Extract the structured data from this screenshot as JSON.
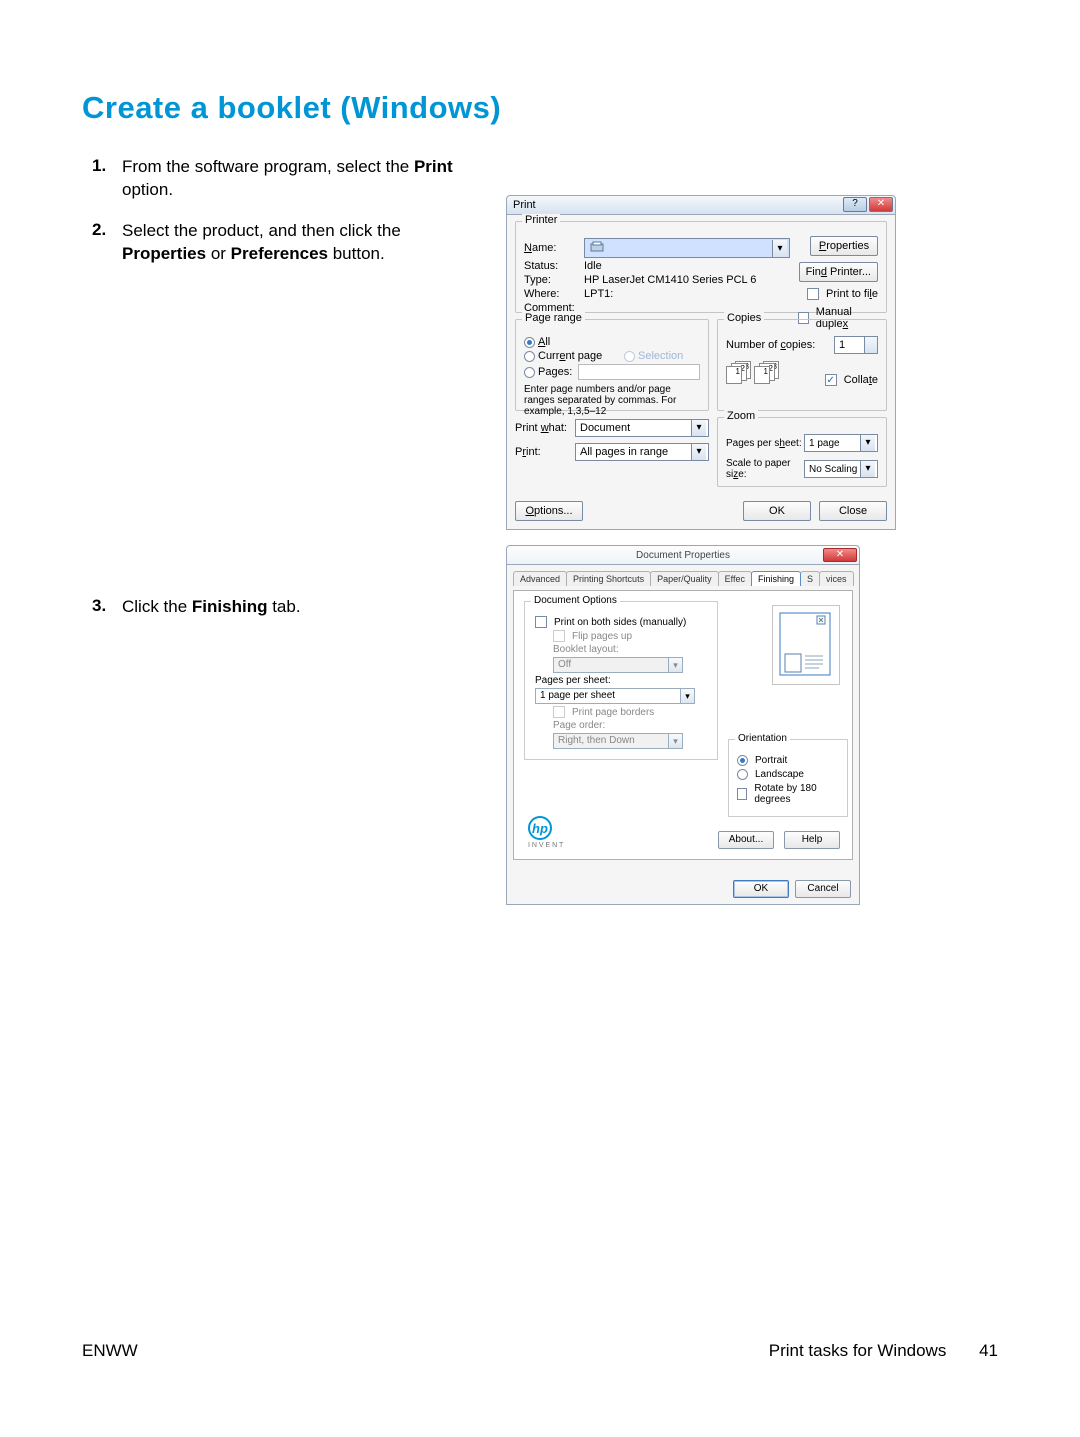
{
  "title": "Create a booklet (Windows)",
  "steps": [
    {
      "num": "1.",
      "text_before": "From the software program, select the ",
      "bold1": "Print",
      "text_mid": " option."
    },
    {
      "num": "2.",
      "text_before": "Select the product, and then click the ",
      "bold1": "Properties",
      "text_mid": " or ",
      "bold2": "Preferences",
      "text_after": " button."
    },
    {
      "num": "3.",
      "text_before": "Click the ",
      "bold1": "Finishing",
      "text_mid": " tab."
    }
  ],
  "print_dialog": {
    "title": "Print",
    "wb_help": "?",
    "wb_close": "✕",
    "printer": {
      "group": "Printer",
      "name_label": "Name:",
      "status_label": "Status:",
      "status_val": "Idle",
      "type_label": "Type:",
      "type_val": "HP LaserJet CM1410 Series PCL 6",
      "where_label": "Where:",
      "where_val": "LPT1:",
      "comment_label": "Comment:",
      "btn_properties": "Properties",
      "btn_find": "Find Printer...",
      "chk_print_to_file": "Print to file",
      "chk_manual_duplex": "Manual duplex"
    },
    "page_range": {
      "group": "Page range",
      "all": "All",
      "current": "Current page",
      "selection": "Selection",
      "pages": "Pages:",
      "hint": "Enter page numbers and/or page ranges separated by commas.  For example, 1,3,5–12"
    },
    "copies": {
      "group": "Copies",
      "num_label": "Number of copies:",
      "num_val": "1",
      "collate": "Collate"
    },
    "print_what_label": "Print what:",
    "print_what_val": "Document",
    "print_label": "Print:",
    "print_val": "All pages in range",
    "zoom": {
      "group": "Zoom",
      "pps_label": "Pages per sheet:",
      "pps_val": "1 page",
      "scale_label": "Scale to paper size:",
      "scale_val": "No Scaling"
    },
    "btn_options": "Options...",
    "btn_ok": "OK",
    "btn_close": "Close"
  },
  "prop_dialog": {
    "title": "Document Properties",
    "close": "✕",
    "tabs": [
      "Advanced",
      "Printing Shortcuts",
      "Paper/Quality",
      "Effec",
      "Finishing",
      "S",
      "vices"
    ],
    "doc_options": {
      "group": "Document Options",
      "print_both_sides": "Print on both sides (manually)",
      "flip_pages_up": "Flip pages up",
      "booklet_layout_label": "Booklet layout:",
      "booklet_layout_val": "Off",
      "pages_per_sheet_label": "Pages per sheet:",
      "pages_per_sheet_val": "1 page per sheet",
      "print_page_borders": "Print page borders",
      "page_order_label": "Page order:",
      "page_order_val": "Right, then Down"
    },
    "orientation": {
      "group": "Orientation",
      "portrait": "Portrait",
      "landscape": "Landscape",
      "rotate": "Rotate by 180 degrees"
    },
    "btn_about": "About...",
    "btn_help": "Help",
    "btn_ok": "OK",
    "btn_cancel": "Cancel",
    "logo_sub": "I N V E N T"
  },
  "footer": {
    "left": "ENWW",
    "right_text": "Print tasks for Windows",
    "page_num": "41"
  }
}
